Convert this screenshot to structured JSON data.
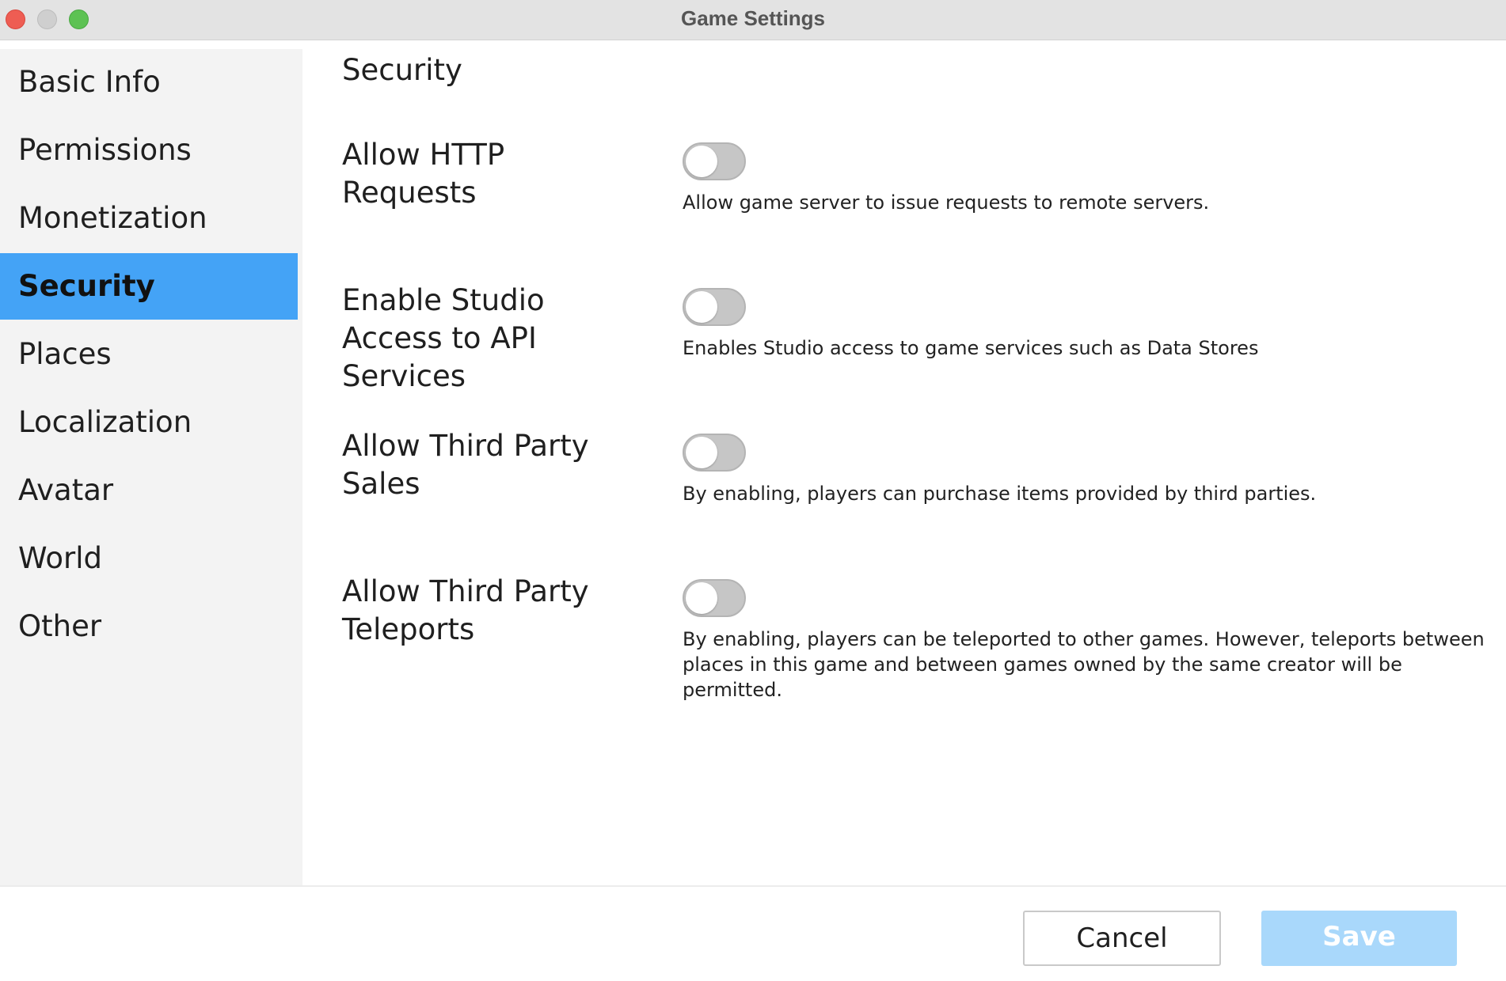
{
  "window": {
    "title": "Game Settings"
  },
  "sidebar": {
    "items": [
      {
        "label": "Basic Info",
        "active": false
      },
      {
        "label": "Permissions",
        "active": false
      },
      {
        "label": "Monetization",
        "active": false
      },
      {
        "label": "Security",
        "active": true
      },
      {
        "label": "Places",
        "active": false
      },
      {
        "label": "Localization",
        "active": false
      },
      {
        "label": "Avatar",
        "active": false
      },
      {
        "label": "World",
        "active": false
      },
      {
        "label": "Other",
        "active": false
      }
    ]
  },
  "main": {
    "section_title": "Security",
    "settings": [
      {
        "label": "Allow HTTP Requests",
        "enabled": false,
        "description": "Allow game server to issue requests to remote servers."
      },
      {
        "label": "Enable Studio Access to API Services",
        "enabled": false,
        "description": "Enables Studio access to game services such as Data Stores"
      },
      {
        "label": "Allow Third Party Sales",
        "enabled": false,
        "description": "By enabling, players can purchase items provided by third parties."
      },
      {
        "label": "Allow Third Party Teleports",
        "enabled": false,
        "description": "By enabling, players can be teleported to other games. However, teleports between places in this game and between games owned by the same creator will be permitted."
      }
    ]
  },
  "footer": {
    "cancel_label": "Cancel",
    "save_label": "Save"
  },
  "colors": {
    "active_nav": "#44a3f6",
    "save_button_disabled": "#a9d8fb",
    "toggle_off": "#c6c6c6",
    "close": "#ee5d53",
    "minimize": "#cfcfcf",
    "maximize": "#5dc253"
  }
}
